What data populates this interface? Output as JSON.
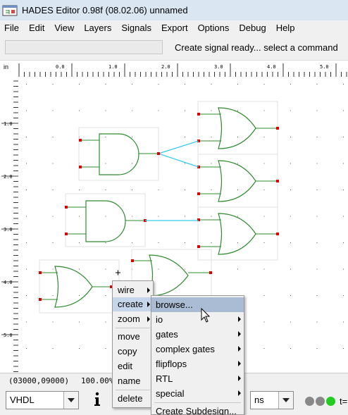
{
  "window": {
    "title": "HADES Editor 0.98f (08.02.06)   unnamed"
  },
  "menubar": [
    "File",
    "Edit",
    "View",
    "Layers",
    "Signals",
    "Export",
    "Options",
    "Debug",
    "Help"
  ],
  "status": {
    "message": "Create signal ready... select a command"
  },
  "ruler": {
    "unit": "in",
    "labels": [
      "0.0",
      "1.0",
      "2.0",
      "3.0",
      "4.0",
      "5.0"
    ]
  },
  "vruler": {
    "labels": [
      "1.0",
      "2.0",
      "3.0",
      "4.0",
      "5.0"
    ]
  },
  "bottom": {
    "coords": "(03000,09000)",
    "zoom": "100.00%",
    "language": "VHDL",
    "time_unit": "ns",
    "time_label": "t=",
    "leds": [
      "#888888",
      "#888888",
      "#22cc22"
    ]
  },
  "context_menu": {
    "items": [
      {
        "label": "wire",
        "submenu": true
      },
      {
        "label": "create",
        "submenu": true,
        "highlighted": true
      },
      {
        "label": "zoom",
        "submenu": true
      },
      {
        "label": "move"
      },
      {
        "label": "copy"
      },
      {
        "label": "edit"
      },
      {
        "label": "name"
      },
      {
        "label": "delete"
      }
    ]
  },
  "create_submenu": {
    "items": [
      {
        "label": "browse...",
        "highlighted": true
      },
      {
        "label": "io",
        "submenu": true
      },
      {
        "label": "gates",
        "submenu": true
      },
      {
        "label": "complex gates",
        "submenu": true
      },
      {
        "label": "flipflops",
        "submenu": true
      },
      {
        "label": "RTL",
        "submenu": true
      },
      {
        "label": "special",
        "submenu": true
      },
      {
        "label": "Create Subdesign..."
      }
    ]
  },
  "colors": {
    "gate": "#2e8b2e",
    "wire": "#33ccee",
    "pin": "#dd0000",
    "menu_highlight": "#a9bcd4"
  },
  "icons": [
    "app-icon",
    "info-icon",
    "chevron-down-icon",
    "submenu-arrow-icon",
    "cursor-icon",
    "crosshair-icon"
  ]
}
